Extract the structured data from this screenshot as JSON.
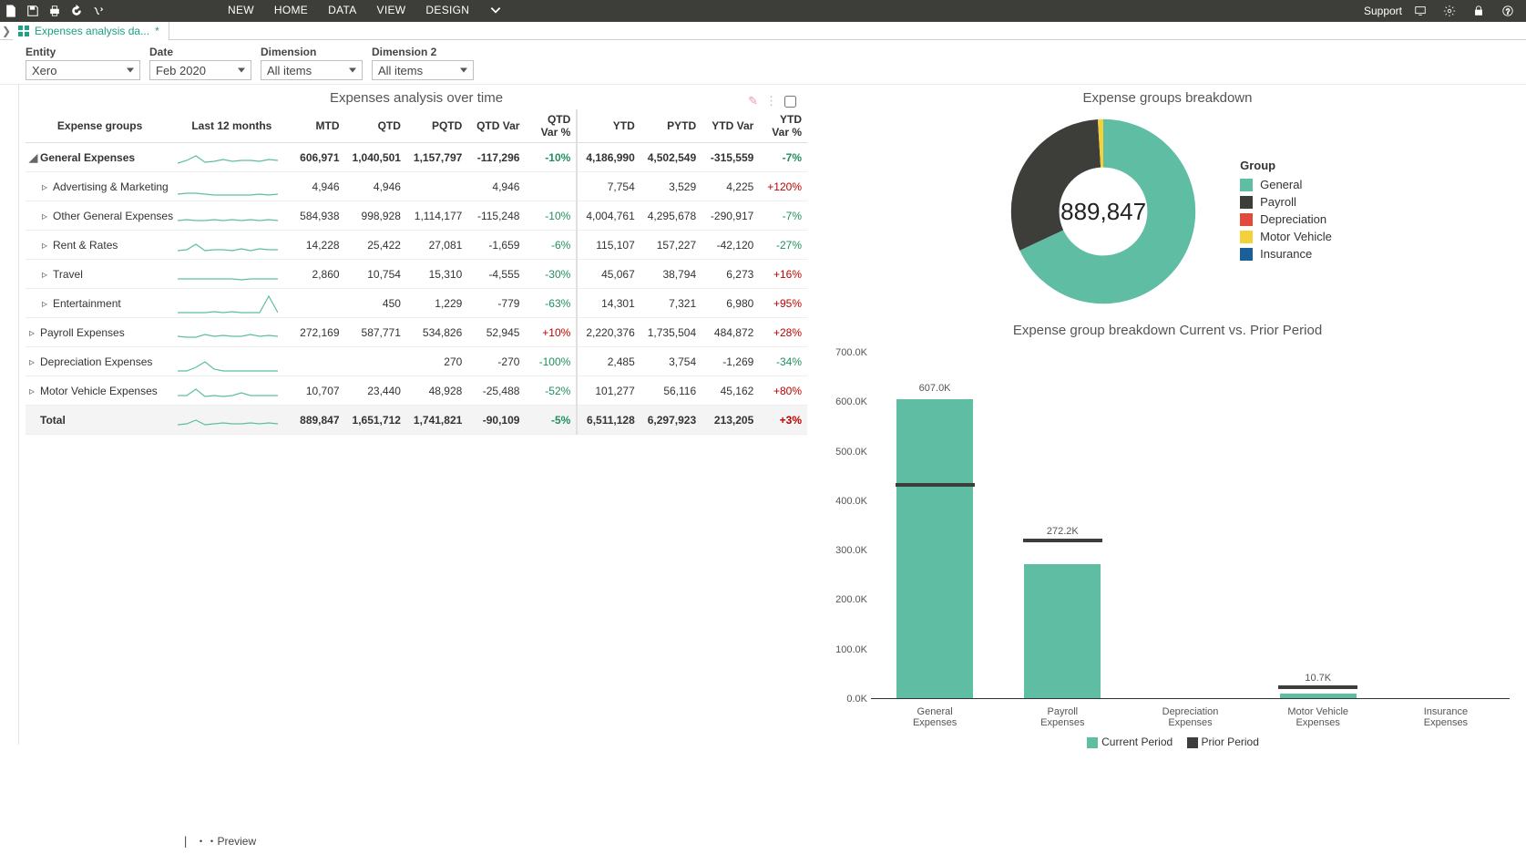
{
  "toolbar": {
    "menu": [
      "NEW",
      "HOME",
      "DATA",
      "VIEW",
      "DESIGN"
    ],
    "support": "Support"
  },
  "sheet": {
    "tab_label": "Expenses analysis da...",
    "tab_dirty": "*"
  },
  "filters": {
    "entity_label": "Entity",
    "entity_value": "Xero",
    "date_label": "Date",
    "date_value": "Feb 2020",
    "dim_label": "Dimension",
    "dim_value": "All items",
    "dim2_label": "Dimension 2",
    "dim2_value": "All items"
  },
  "table": {
    "title": "Expenses analysis over time",
    "cols": [
      "Expense groups",
      "Last 12 months",
      "MTD",
      "QTD",
      "PQTD",
      "QTD Var",
      "QTD Var %",
      "YTD",
      "PYTD",
      "YTD Var",
      "YTD Var %"
    ],
    "rows": [
      {
        "name": "General Expenses",
        "bold": true,
        "expand": "open",
        "spark": [
          6,
          9,
          14,
          7,
          8,
          10,
          8,
          9,
          9,
          8,
          10,
          9
        ],
        "mtd": "606,971",
        "qtd": "1,040,501",
        "pqtd": "1,157,797",
        "qtdvar": "-117,296",
        "qtdvarp": "-10%",
        "qtdvarp_cls": "pos",
        "ytd": "4,186,990",
        "pytd": "4,502,549",
        "ytdvar": "-315,559",
        "ytdvarp": "-7%",
        "ytdvarp_cls": "pos"
      },
      {
        "name": "Advertising & Marketing",
        "expand": "closed",
        "indent": true,
        "spark": [
          4,
          5,
          5,
          4,
          3,
          3,
          3,
          3,
          3,
          4,
          3,
          4
        ],
        "mtd": "4,946",
        "qtd": "4,946",
        "pqtd": "",
        "qtdvar": "4,946",
        "qtdvarp": "",
        "ytd": "7,754",
        "pytd": "3,529",
        "ytdvar": "4,225",
        "ytdvarp": "+120%",
        "ytdvarp_cls": "neg"
      },
      {
        "name": "Other General Expenses",
        "expand": "closed",
        "indent": true,
        "spark": [
          7,
          8,
          7,
          7,
          8,
          7,
          8,
          7,
          8,
          7,
          8,
          7
        ],
        "mtd": "584,938",
        "qtd": "998,928",
        "pqtd": "1,114,177",
        "qtdvar": "-115,248",
        "qtdvarp": "-10%",
        "qtdvarp_cls": "pos",
        "ytd": "4,004,761",
        "pytd": "4,295,678",
        "ytdvar": "-290,917",
        "ytdvarp": "-7%",
        "ytdvarp_cls": "pos"
      },
      {
        "name": "Rent & Rates",
        "expand": "closed",
        "indent": true,
        "spark": [
          6,
          7,
          13,
          6,
          7,
          7,
          6,
          8,
          6,
          8,
          7,
          7
        ],
        "mtd": "14,228",
        "qtd": "25,422",
        "pqtd": "27,081",
        "qtdvar": "-1,659",
        "qtdvarp": "-6%",
        "qtdvarp_cls": "pos",
        "ytd": "115,107",
        "pytd": "157,227",
        "ytdvar": "-42,120",
        "ytdvarp": "-27%",
        "ytdvarp_cls": "pos"
      },
      {
        "name": "Travel",
        "expand": "closed",
        "indent": true,
        "spark": [
          7,
          7,
          7,
          7,
          7,
          7,
          7,
          6,
          7,
          7,
          7,
          7
        ],
        "mtd": "2,860",
        "qtd": "10,754",
        "pqtd": "15,310",
        "qtdvar": "-4,555",
        "qtdvarp": "-30%",
        "qtdvarp_cls": "pos",
        "ytd": "45,067",
        "pytd": "38,794",
        "ytdvar": "6,273",
        "ytdvarp": "+16%",
        "ytdvarp_cls": "neg"
      },
      {
        "name": "Entertainment",
        "expand": "closed",
        "indent": true,
        "spark": [
          2,
          2,
          2,
          2,
          3,
          2,
          3,
          2,
          2,
          2,
          20,
          2
        ],
        "mtd": "",
        "qtd": "450",
        "pqtd": "1,229",
        "qtdvar": "-779",
        "qtdvarp": "-63%",
        "qtdvarp_cls": "pos",
        "ytd": "14,301",
        "pytd": "7,321",
        "ytdvar": "6,980",
        "ytdvarp": "+95%",
        "ytdvarp_cls": "neg"
      },
      {
        "name": "Payroll Expenses",
        "expand": "closed",
        "spark": [
          8,
          7,
          7,
          10,
          8,
          9,
          8,
          8,
          10,
          8,
          9,
          8
        ],
        "mtd": "272,169",
        "qtd": "587,771",
        "pqtd": "534,826",
        "qtdvar": "52,945",
        "qtdvarp": "+10%",
        "qtdvarp_cls": "neg",
        "ytd": "2,220,376",
        "pytd": "1,735,504",
        "ytdvar": "484,872",
        "ytdvarp": "+28%",
        "ytdvarp_cls": "neg"
      },
      {
        "name": "Depreciation Expenses",
        "expand": "closed",
        "spark": [
          2,
          2,
          6,
          12,
          4,
          2,
          2,
          2,
          2,
          2,
          2,
          2
        ],
        "mtd": "",
        "qtd": "",
        "pqtd": "270",
        "qtdvar": "-270",
        "qtdvarp": "-100%",
        "qtdvarp_cls": "pos",
        "ytd": "2,485",
        "pytd": "3,754",
        "ytdvar": "-1,269",
        "ytdvarp": "-34%",
        "ytdvarp_cls": "pos"
      },
      {
        "name": "Motor Vehicle Expenses",
        "expand": "closed",
        "spark": [
          7,
          7,
          14,
          6,
          7,
          6,
          7,
          10,
          7,
          7,
          7,
          7
        ],
        "mtd": "10,707",
        "qtd": "23,440",
        "pqtd": "48,928",
        "qtdvar": "-25,488",
        "qtdvarp": "-52%",
        "qtdvarp_cls": "pos",
        "ytd": "101,277",
        "pytd": "56,116",
        "ytdvar": "45,162",
        "ytdvarp": "+80%",
        "ytdvarp_cls": "neg"
      },
      {
        "name": "Total",
        "total": true,
        "spark": [
          7,
          8,
          12,
          7,
          8,
          9,
          8,
          8,
          9,
          8,
          9,
          8
        ],
        "mtd": "889,847",
        "qtd": "1,651,712",
        "pqtd": "1,741,821",
        "qtdvar": "-90,109",
        "qtdvarp": "-5%",
        "qtdvarp_cls": "pos",
        "ytd": "6,511,128",
        "pytd": "6,297,923",
        "ytdvar": "213,205",
        "ytdvarp": "+3%",
        "ytdvarp_cls": "neg"
      }
    ]
  },
  "donut": {
    "title": "Expense groups breakdown",
    "center": "889,847",
    "legend_title": "Group",
    "items": [
      {
        "name": "General",
        "color": "#5fbda3"
      },
      {
        "name": "Payroll",
        "color": "#3d3d39"
      },
      {
        "name": "Depreciation",
        "color": "#e24a3b"
      },
      {
        "name": "Motor Vehicle",
        "color": "#f4d13b"
      },
      {
        "name": "Insurance",
        "color": "#1a5f99"
      }
    ]
  },
  "bars": {
    "title": "Expense group breakdown Current vs. Prior Period",
    "ymax": 700000,
    "yticks": [
      "700.0K",
      "600.0K",
      "500.0K",
      "400.0K",
      "300.0K",
      "200.0K",
      "100.0K",
      "0.0K"
    ],
    "series": [
      {
        "cat": "General Expenses",
        "cur": 607000,
        "prior": 430000,
        "lbl": "607.0K"
      },
      {
        "cat": "Payroll Expenses",
        "cur": 272200,
        "prior": 316000,
        "lbl": "272.2K"
      },
      {
        "cat": "Depreciation Expenses",
        "cur": 0,
        "prior": 0,
        "lbl": ""
      },
      {
        "cat": "Motor Vehicle Expenses",
        "cur": 10700,
        "prior": 20000,
        "lbl": "10.7K"
      },
      {
        "cat": "Insurance Expenses",
        "cur": 0,
        "prior": 0,
        "lbl": ""
      }
    ],
    "legend_cur": "Current Period",
    "legend_prior": "Prior Period"
  },
  "footer": {
    "preview": "Preview"
  },
  "chart_data": [
    {
      "type": "pie",
      "title": "Expense groups breakdown",
      "categories": [
        "General",
        "Payroll",
        "Depreciation",
        "Motor Vehicle",
        "Insurance"
      ],
      "values": [
        606971,
        272169,
        0,
        10707,
        0
      ],
      "total_label": "889,847"
    },
    {
      "type": "bar",
      "title": "Expense group breakdown Current vs. Prior Period",
      "categories": [
        "General Expenses",
        "Payroll Expenses",
        "Depreciation Expenses",
        "Motor Vehicle Expenses",
        "Insurance Expenses"
      ],
      "series": [
        {
          "name": "Current Period",
          "values": [
            607000,
            272200,
            0,
            10700,
            0
          ]
        },
        {
          "name": "Prior Period",
          "values": [
            430000,
            316000,
            0,
            20000,
            0
          ]
        }
      ],
      "ylim": [
        0,
        700000
      ]
    }
  ]
}
